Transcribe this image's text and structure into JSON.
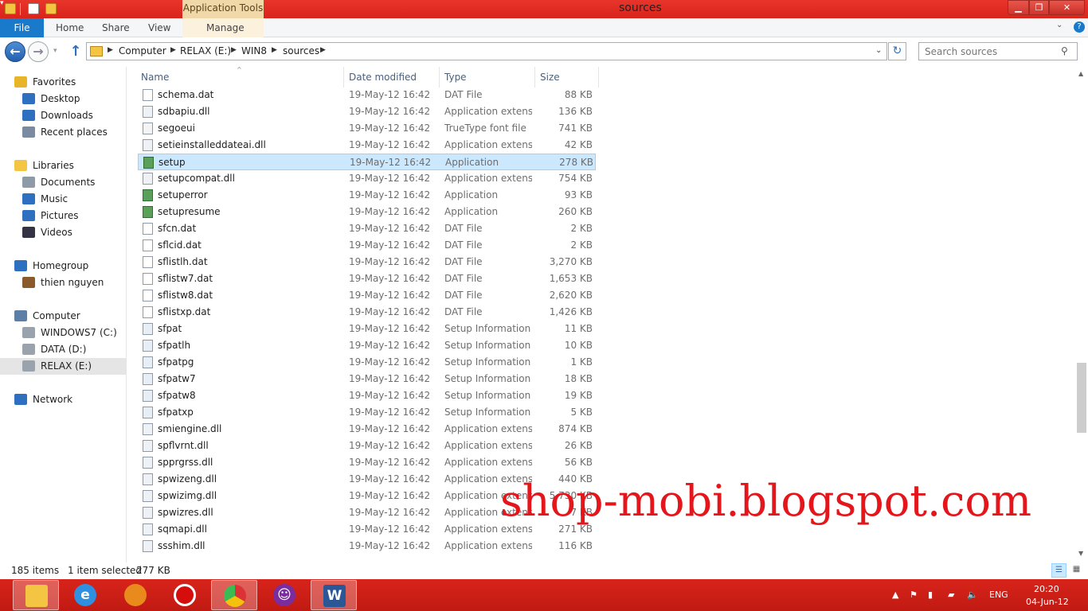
{
  "window": {
    "title": "sources",
    "contextual_tab_group": "Application Tools"
  },
  "ribbon": {
    "tabs": [
      "File",
      "Home",
      "Share",
      "View",
      "Manage"
    ]
  },
  "address": {
    "crumbs": [
      "Computer",
      "RELAX (E:)",
      "WIN8",
      "sources"
    ]
  },
  "search": {
    "placeholder": "Search sources"
  },
  "nav": [
    {
      "label": "Favorites",
      "icon": "star-icon"
    },
    {
      "label": "Desktop",
      "icon": "desktop-icon"
    },
    {
      "label": "Downloads",
      "icon": "downloads-icon"
    },
    {
      "label": "Recent places",
      "icon": "recent-places-icon"
    },
    {
      "label": "Libraries",
      "icon": "libraries-icon"
    },
    {
      "label": "Documents",
      "icon": "documents-icon"
    },
    {
      "label": "Music",
      "icon": "music-icon"
    },
    {
      "label": "Pictures",
      "icon": "pictures-icon"
    },
    {
      "label": "Videos",
      "icon": "videos-icon"
    },
    {
      "label": "Homegroup",
      "icon": "homegroup-icon"
    },
    {
      "label": "thien nguyen",
      "icon": "user-icon"
    },
    {
      "label": "Computer",
      "icon": "computer-icon"
    },
    {
      "label": "WINDOWS7 (C:)",
      "icon": "drive-icon"
    },
    {
      "label": "DATA (D:)",
      "icon": "drive-icon"
    },
    {
      "label": "RELAX (E:)",
      "icon": "drive-icon"
    },
    {
      "label": "Network",
      "icon": "network-icon"
    }
  ],
  "columns": {
    "name": "Name",
    "date": "Date modified",
    "type": "Type",
    "size": "Size"
  },
  "files": [
    {
      "name": "schema.dat",
      "date": "19-May-12 16:42",
      "type": "DAT File",
      "size": "88 KB",
      "icon": "file-icon"
    },
    {
      "name": "sdbapiu.dll",
      "date": "19-May-12 16:42",
      "type": "Application extens...",
      "size": "136 KB",
      "icon": "dll-icon"
    },
    {
      "name": "segoeui",
      "date": "19-May-12 16:42",
      "type": "TrueType font file",
      "size": "741 KB",
      "icon": "font-icon"
    },
    {
      "name": "setieinstalleddateai.dll",
      "date": "19-May-12 16:42",
      "type": "Application extens...",
      "size": "42 KB",
      "icon": "dll-icon"
    },
    {
      "name": "setup",
      "date": "19-May-12 16:42",
      "type": "Application",
      "size": "278 KB",
      "icon": "app-icon"
    },
    {
      "name": "setupcompat.dll",
      "date": "19-May-12 16:42",
      "type": "Application extens...",
      "size": "754 KB",
      "icon": "dll-icon"
    },
    {
      "name": "setuperror",
      "date": "19-May-12 16:42",
      "type": "Application",
      "size": "93 KB",
      "icon": "app-icon"
    },
    {
      "name": "setupresume",
      "date": "19-May-12 16:42",
      "type": "Application",
      "size": "260 KB",
      "icon": "app-icon"
    },
    {
      "name": "sfcn.dat",
      "date": "19-May-12 16:42",
      "type": "DAT File",
      "size": "2 KB",
      "icon": "file-icon"
    },
    {
      "name": "sflcid.dat",
      "date": "19-May-12 16:42",
      "type": "DAT File",
      "size": "2 KB",
      "icon": "file-icon"
    },
    {
      "name": "sflistlh.dat",
      "date": "19-May-12 16:42",
      "type": "DAT File",
      "size": "3,270 KB",
      "icon": "file-icon"
    },
    {
      "name": "sflistw7.dat",
      "date": "19-May-12 16:42",
      "type": "DAT File",
      "size": "1,653 KB",
      "icon": "file-icon"
    },
    {
      "name": "sflistw8.dat",
      "date": "19-May-12 16:42",
      "type": "DAT File",
      "size": "2,620 KB",
      "icon": "file-icon"
    },
    {
      "name": "sflistxp.dat",
      "date": "19-May-12 16:42",
      "type": "DAT File",
      "size": "1,426 KB",
      "icon": "file-icon"
    },
    {
      "name": "sfpat",
      "date": "19-May-12 16:42",
      "type": "Setup Information",
      "size": "11 KB",
      "icon": "inf-icon"
    },
    {
      "name": "sfpatlh",
      "date": "19-May-12 16:42",
      "type": "Setup Information",
      "size": "10 KB",
      "icon": "inf-icon"
    },
    {
      "name": "sfpatpg",
      "date": "19-May-12 16:42",
      "type": "Setup Information",
      "size": "1 KB",
      "icon": "inf-icon"
    },
    {
      "name": "sfpatw7",
      "date": "19-May-12 16:42",
      "type": "Setup Information",
      "size": "18 KB",
      "icon": "inf-icon"
    },
    {
      "name": "sfpatw8",
      "date": "19-May-12 16:42",
      "type": "Setup Information",
      "size": "19 KB",
      "icon": "inf-icon"
    },
    {
      "name": "sfpatxp",
      "date": "19-May-12 16:42",
      "type": "Setup Information",
      "size": "5 KB",
      "icon": "inf-icon"
    },
    {
      "name": "smiengine.dll",
      "date": "19-May-12 16:42",
      "type": "Application extens...",
      "size": "874 KB",
      "icon": "dll-icon"
    },
    {
      "name": "spflvrnt.dll",
      "date": "19-May-12 16:42",
      "type": "Application extens...",
      "size": "26 KB",
      "icon": "dll-icon"
    },
    {
      "name": "spprgrss.dll",
      "date": "19-May-12 16:42",
      "type": "Application extens...",
      "size": "56 KB",
      "icon": "dll-icon"
    },
    {
      "name": "spwizeng.dll",
      "date": "19-May-12 16:42",
      "type": "Application extens...",
      "size": "440 KB",
      "icon": "dll-icon"
    },
    {
      "name": "spwizimg.dll",
      "date": "19-May-12 16:42",
      "type": "Application extens...",
      "size": "5,730 KB",
      "icon": "dll-icon"
    },
    {
      "name": "spwizres.dll",
      "date": "19-May-12 16:42",
      "type": "Application extens...",
      "size": "7 KB",
      "icon": "dll-icon"
    },
    {
      "name": "sqmapi.dll",
      "date": "19-May-12 16:42",
      "type": "Application extens...",
      "size": "271 KB",
      "icon": "dll-icon"
    },
    {
      "name": "ssshim.dll",
      "date": "19-May-12 16:42",
      "type": "Application extens...",
      "size": "116 KB",
      "icon": "dll-icon"
    }
  ],
  "status": {
    "count": "185 items",
    "selected": "1 item selected",
    "selected_size": "277 KB"
  },
  "taskbar": {
    "apps": [
      "file-explorer-icon",
      "internet-explorer-icon",
      "firefox-icon",
      "opera-icon",
      "chrome-icon",
      "yahoo-messenger-icon",
      "word-icon"
    ],
    "language": "ENG",
    "time": "20:20",
    "date": "04-Jun-12"
  },
  "watermark": "shop-mobi.blogspot.com",
  "colors": {
    "accent": "#1979ca",
    "selection": "#cce8ff",
    "taskbar": "#d8241b",
    "watermark": "#e4161b"
  }
}
